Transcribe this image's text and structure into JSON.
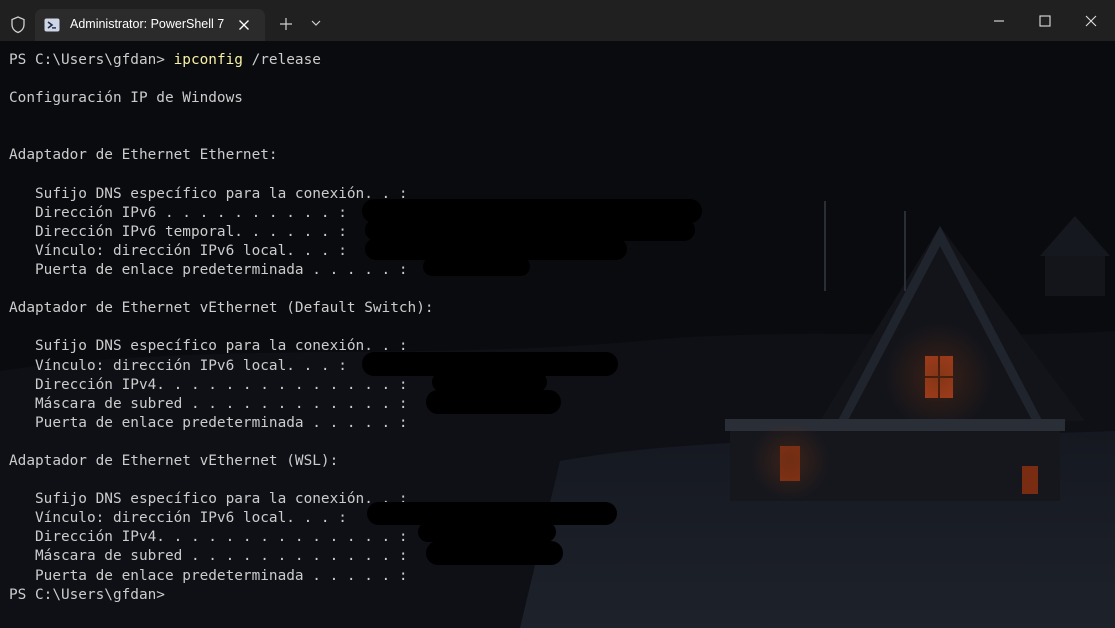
{
  "window": {
    "tab_title": "Administrator: PowerShell 7"
  },
  "icons": {
    "shield": "shield-icon",
    "powershell": "powershell-icon",
    "tab_close": "close-icon",
    "new_tab": "plus-icon",
    "dropdown": "chevron-down-icon",
    "minimize": "minimize-icon",
    "maximize": "maximize-icon",
    "close": "close-icon"
  },
  "colors": {
    "titlebar": "#202020",
    "tab": "#2b2b2b",
    "text": "#cccccc",
    "command": "#f9f1a5"
  },
  "terminal": {
    "prompt1": "PS C:\\Users\\gfdan> ",
    "cmd_name": "ipconfig",
    "cmd_args": " /release",
    "l_title": "Configuración IP de Windows",
    "blank": "",
    "a1_header": "Adaptador de Ethernet Ethernet:",
    "a1_dns": "   Sufijo DNS específico para la conexión. . :",
    "a1_ipv6": "   Dirección IPv6 . . . . . . . . . . :",
    "a1_ipv6_temp": "   Dirección IPv6 temporal. . . . . . :",
    "a1_link": "   Vínculo: dirección IPv6 local. . . :",
    "a1_gateway": "   Puerta de enlace predeterminada . . . . . :",
    "a2_header": "Adaptador de Ethernet vEthernet (Default Switch):",
    "a2_dns": "   Sufijo DNS específico para la conexión. . :",
    "a2_link": "   Vínculo: dirección IPv6 local. . . :",
    "a2_ipv4": "   Dirección IPv4. . . . . . . . . . . . . . :",
    "a2_mask": "   Máscara de subred . . . . . . . . . . . . :",
    "a2_gateway": "   Puerta de enlace predeterminada . . . . . :",
    "a3_header": "Adaptador de Ethernet vEthernet (WSL):",
    "a3_dns": "   Sufijo DNS específico para la conexión. . :",
    "a3_link": "   Vínculo: dirección IPv6 local. . . :",
    "a3_ipv4": "   Dirección IPv4. . . . . . . . . . . . . . :",
    "a3_mask": "   Máscara de subred . . . . . . . . . . . . :",
    "a3_gateway": "   Puerta de enlace predeterminada . . . . . :",
    "prompt2": "PS C:\\Users\\gfdan>"
  }
}
